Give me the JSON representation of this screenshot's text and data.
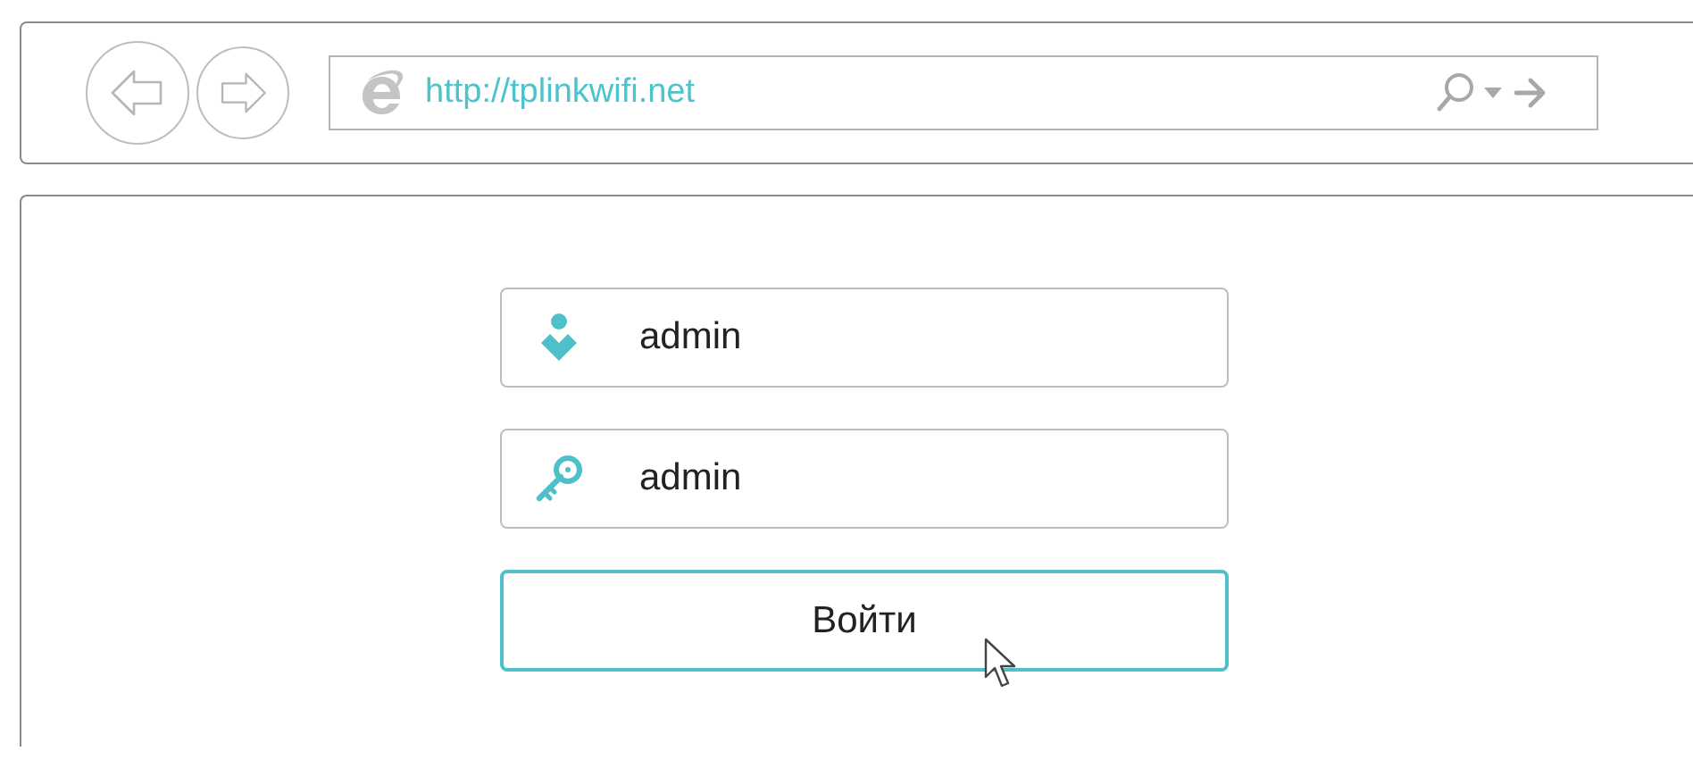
{
  "address_bar": {
    "url": "http://tplinkwifi.net"
  },
  "login_fields": [
    {
      "kind": "user",
      "value": "admin"
    },
    {
      "kind": "password",
      "value": "admin"
    }
  ],
  "login_button": {
    "label": "Войти"
  }
}
